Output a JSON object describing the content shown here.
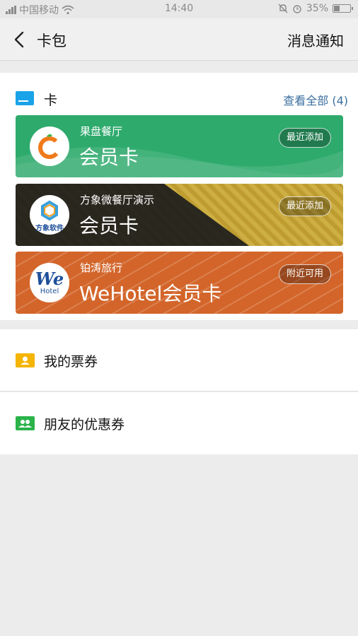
{
  "status_bar": {
    "carrier": "中国移动",
    "time": "14:40",
    "battery": "35%"
  },
  "nav": {
    "title": "卡包",
    "action": "消息通知"
  },
  "cards_section": {
    "title": "卡",
    "see_all": "查看全部 (4)",
    "cards": [
      {
        "merchant": "果盘餐厅",
        "name": "会员卡",
        "badge": "最近添加",
        "color": "#2eaa6d",
        "logo_text": ""
      },
      {
        "merchant": "方象微餐厅演示",
        "name": "会员卡",
        "badge": "最近添加",
        "color": "#c9a83a",
        "logo_text": "方象软件"
      },
      {
        "merchant": "铂涛旅行",
        "name": "WeHotel会员卡",
        "badge": "附近可用",
        "color": "#d3652a",
        "logo_text": "We",
        "logo_subtext": "Hotel"
      }
    ]
  },
  "menu": {
    "tickets": "我的票券",
    "friends_coupons": "朋友的优惠券"
  }
}
